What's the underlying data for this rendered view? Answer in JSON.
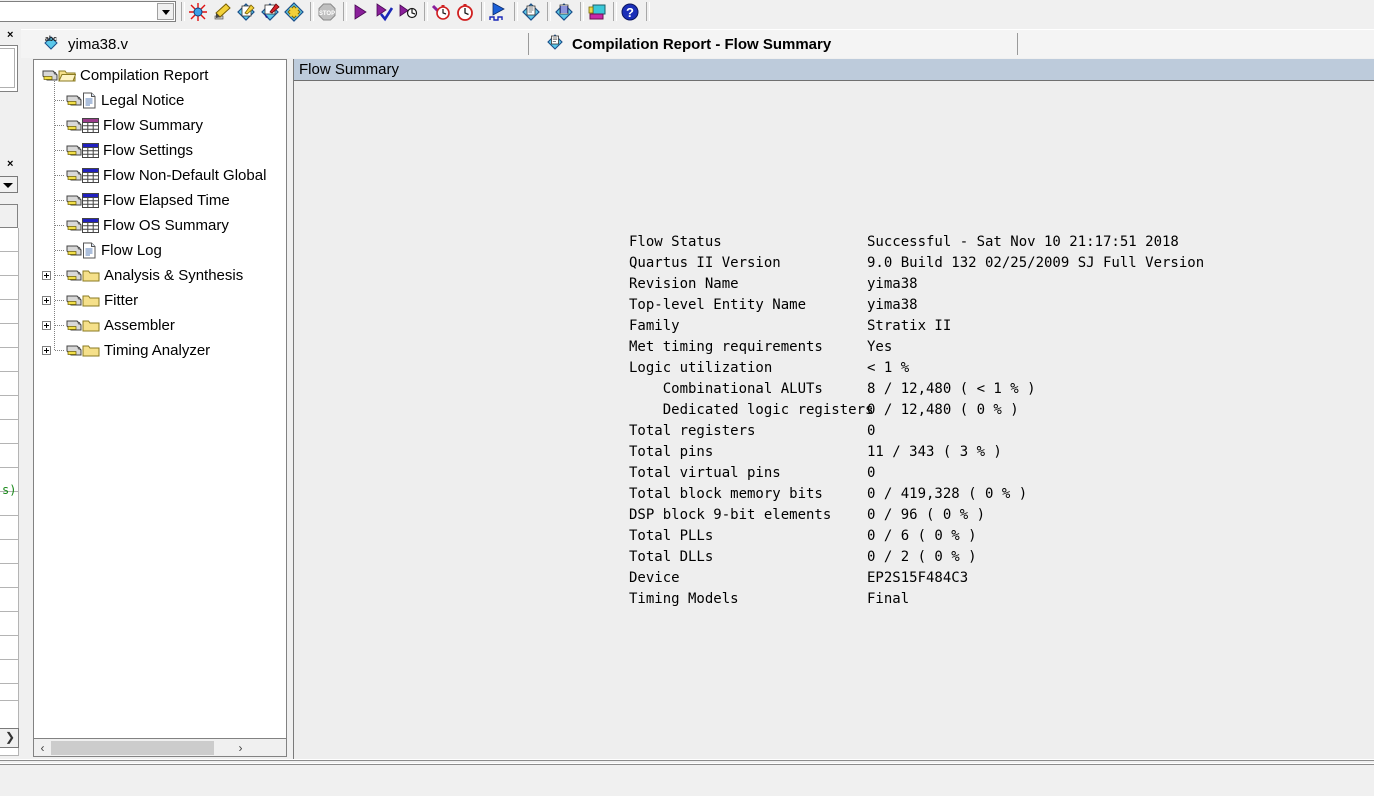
{
  "toolbar": {
    "combo_value": "",
    "combo_placeholder": "",
    "icons": [
      {
        "name": "stop-compilation-icon",
        "label": "Stop"
      },
      {
        "name": "analyze-current-file-icon",
        "label": "Analyze Current File"
      },
      {
        "name": "analysis-synthesis-icon",
        "label": "Analysis & Synthesis"
      },
      {
        "name": "analysis-elaboration-icon",
        "label": "Analysis & Elaboration"
      },
      {
        "name": "compile-design-icon",
        "label": "Start Compilation"
      },
      {
        "name": "stop-sign-icon",
        "label": "Stop Processing"
      },
      {
        "name": "start-compilation-play-icon",
        "label": "Start Compilation"
      },
      {
        "name": "compile-and-simulate-icon",
        "label": "Compile and Simulate"
      },
      {
        "name": "start-simulation-icon",
        "label": "Start Simulation"
      },
      {
        "name": "timing-analyzer-icon",
        "label": "Timing Analyzer"
      },
      {
        "name": "classic-timing-analyzer-icon",
        "label": "Classic Timing Analyzer"
      },
      {
        "name": "waveform-editor-icon",
        "label": "Waveform Editor"
      },
      {
        "name": "programmer-icon",
        "label": "Programmer"
      },
      {
        "name": "signaltap-icon",
        "label": "SignalTap II"
      },
      {
        "name": "rtl-viewer-icon",
        "label": "RTL Viewer"
      },
      {
        "name": "help-icon",
        "label": "Help"
      }
    ]
  },
  "left_panels": {
    "close_labels": [
      "×",
      "×"
    ],
    "editor_fragment": "s)",
    "expand_arrow": "❯"
  },
  "tabs": [
    {
      "name": "tab-yima38-v",
      "label": "yima38.v",
      "icon": "abc-verilog-file-icon",
      "bold": false,
      "active": false
    },
    {
      "name": "tab-compilation-report",
      "label": "Compilation Report - Flow Summary",
      "icon": "report-diamond-icon",
      "bold": true,
      "active": true
    }
  ],
  "tree": {
    "items": [
      {
        "label": "Compilation Report",
        "icon": "folder-open-icon",
        "depth": 0,
        "expandable": false,
        "expanded": true
      },
      {
        "label": "Legal Notice",
        "icon": "document-icon",
        "depth": 1,
        "expandable": false
      },
      {
        "label": "Flow Summary",
        "icon": "table-magenta-icon",
        "depth": 1,
        "expandable": false,
        "selected": true
      },
      {
        "label": "Flow Settings",
        "icon": "table-blue-icon",
        "depth": 1,
        "expandable": false
      },
      {
        "label": "Flow Non-Default Global",
        "icon": "table-blue-icon",
        "depth": 1,
        "expandable": false
      },
      {
        "label": "Flow Elapsed Time",
        "icon": "table-blue-icon",
        "depth": 1,
        "expandable": false
      },
      {
        "label": "Flow OS Summary",
        "icon": "table-blue-icon",
        "depth": 1,
        "expandable": false
      },
      {
        "label": "Flow Log",
        "icon": "document-icon",
        "depth": 1,
        "expandable": false
      },
      {
        "label": "Analysis & Synthesis",
        "icon": "folder-icon",
        "depth": 1,
        "expandable": true,
        "expanded": false
      },
      {
        "label": "Fitter",
        "icon": "folder-icon",
        "depth": 1,
        "expandable": true,
        "expanded": false
      },
      {
        "label": "Assembler",
        "icon": "folder-icon",
        "depth": 1,
        "expandable": true,
        "expanded": false
      },
      {
        "label": "Timing Analyzer",
        "icon": "folder-icon",
        "depth": 1,
        "expandable": true,
        "expanded": false
      }
    ],
    "scroll_left_arrow": "‹",
    "scroll_right_arrow": "›"
  },
  "report": {
    "header": "Flow Summary",
    "rows": [
      {
        "key": "Flow Status",
        "value": "Successful - Sat Nov 10 21:17:51 2018"
      },
      {
        "key": "Quartus II Version",
        "value": "9.0 Build 132 02/25/2009 SJ Full Version"
      },
      {
        "key": "Revision Name",
        "value": "yima38"
      },
      {
        "key": "Top-level Entity Name",
        "value": "yima38"
      },
      {
        "key": "Family",
        "value": "Stratix II"
      },
      {
        "key": "Met timing requirements",
        "value": "Yes"
      },
      {
        "key": "Logic utilization",
        "value": "< 1 %"
      },
      {
        "key": "    Combinational ALUTs",
        "value": "8 / 12,480 ( < 1 % )"
      },
      {
        "key": "    Dedicated logic registers",
        "value": "0 / 12,480 ( 0 % )"
      },
      {
        "key": "Total registers",
        "value": "0"
      },
      {
        "key": "Total pins",
        "value": "11 / 343 ( 3 % )"
      },
      {
        "key": "Total virtual pins",
        "value": "0"
      },
      {
        "key": "Total block memory bits",
        "value": "0 / 419,328 ( 0 % )"
      },
      {
        "key": "DSP block 9-bit elements",
        "value": "0 / 96 ( 0 % )"
      },
      {
        "key": "Total PLLs",
        "value": "0 / 6 ( 0 % )"
      },
      {
        "key": "Total DLLs",
        "value": "0 / 2 ( 0 % )"
      },
      {
        "key": "Device",
        "value": "EP2S15F484C3"
      },
      {
        "key": "Timing Models",
        "value": "Final"
      }
    ]
  },
  "colors": {
    "header_bar": "#bdcbdb",
    "content_bg": "#eeeeee",
    "chrome": "#f0f0f0",
    "tree_bg": "#ffffff",
    "border": "#828282",
    "editor_green": "#1a8a1a",
    "folder_yellow": "#f5e08a",
    "table_magenta": "#9b3c8c",
    "table_blue": "#2020c0"
  }
}
